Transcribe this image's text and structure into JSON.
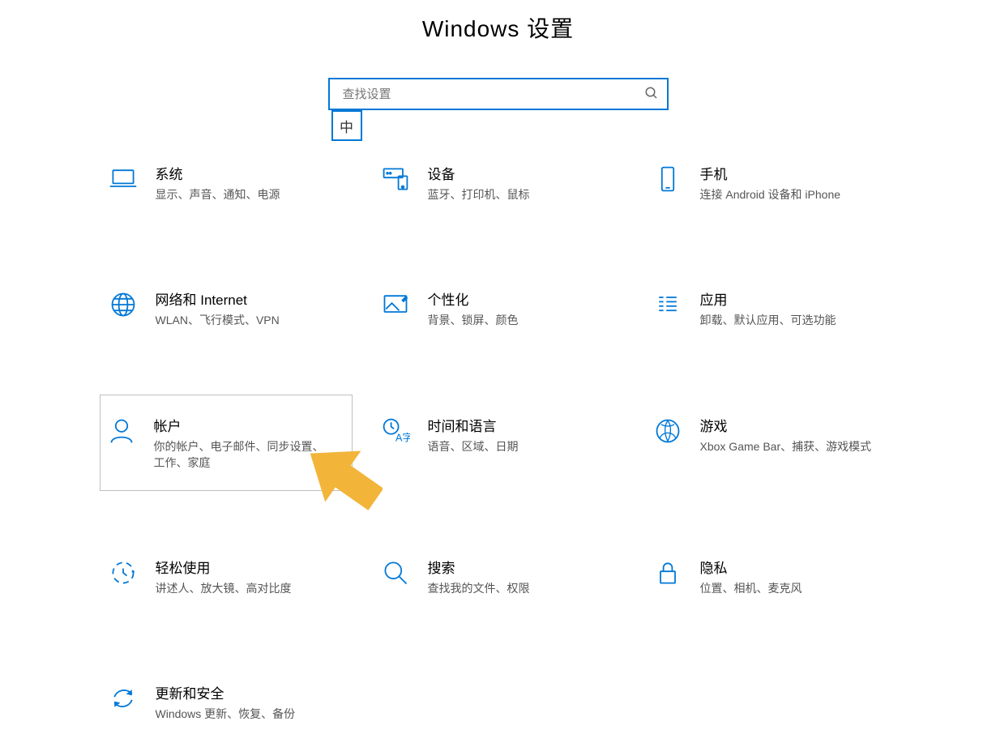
{
  "header": {
    "title": "Windows 设置"
  },
  "search": {
    "placeholder": "查找设置"
  },
  "ime": {
    "label": "中"
  },
  "tiles": [
    {
      "id": "system",
      "icon": "laptop",
      "title": "系统",
      "desc": "显示、声音、通知、电源"
    },
    {
      "id": "devices",
      "icon": "devices",
      "title": "设备",
      "desc": "蓝牙、打印机、鼠标"
    },
    {
      "id": "phone",
      "icon": "phone",
      "title": "手机",
      "desc": "连接 Android 设备和 iPhone"
    },
    {
      "id": "network",
      "icon": "globe",
      "title": "网络和 Internet",
      "desc": "WLAN、飞行模式、VPN"
    },
    {
      "id": "personalize",
      "icon": "personalize",
      "title": "个性化",
      "desc": "背景、锁屏、颜色"
    },
    {
      "id": "apps",
      "icon": "apps",
      "title": "应用",
      "desc": "卸载、默认应用、可选功能"
    },
    {
      "id": "accounts",
      "icon": "person",
      "title": "帐户",
      "desc": "你的帐户、电子邮件、同步设置、工作、家庭",
      "highlighted": true
    },
    {
      "id": "time",
      "icon": "time-lang",
      "title": "时间和语言",
      "desc": "语音、区域、日期"
    },
    {
      "id": "gaming",
      "icon": "xbox",
      "title": "游戏",
      "desc": "Xbox Game Bar、捕获、游戏模式"
    },
    {
      "id": "ease",
      "icon": "ease",
      "title": "轻松使用",
      "desc": "讲述人、放大镜、高对比度"
    },
    {
      "id": "search",
      "icon": "magnify",
      "title": "搜索",
      "desc": "查找我的文件、权限"
    },
    {
      "id": "privacy",
      "icon": "lock",
      "title": "隐私",
      "desc": "位置、相机、麦克风"
    },
    {
      "id": "update",
      "icon": "sync",
      "title": "更新和安全",
      "desc": "Windows 更新、恢复、备份"
    }
  ]
}
